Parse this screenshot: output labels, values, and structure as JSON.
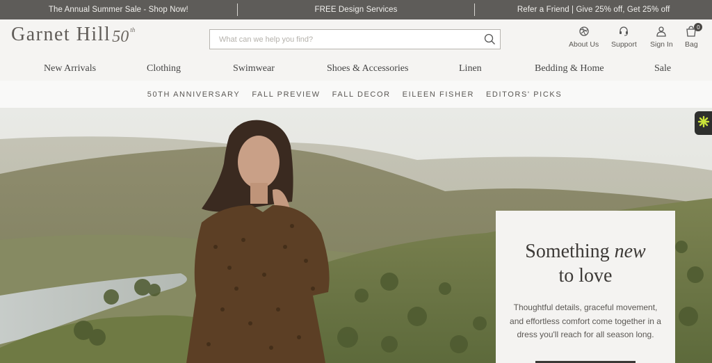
{
  "promo_bar": {
    "items": [
      "The Annual Summer Sale - Shop Now!",
      "FREE Design Services",
      "Refer a Friend | Give 25% off, Get 25% off"
    ]
  },
  "header": {
    "logo_text": "Garnet Hill",
    "logo_anniversary": "50",
    "logo_anniversary_suffix": "th",
    "search_placeholder": "What can we help you find?",
    "utility": {
      "about": "About Us",
      "support": "Support",
      "signin": "Sign In",
      "bag": "Bag",
      "bag_count": "0"
    }
  },
  "main_nav": [
    "New Arrivals",
    "Clothing",
    "Swimwear",
    "Shoes & Accessories",
    "Linen",
    "Bedding & Home",
    "Sale"
  ],
  "sub_nav": [
    "50TH ANNIVERSARY",
    "FALL PREVIEW",
    "FALL DECOR",
    "EILEEN FISHER",
    "EDITORS' PICKS"
  ],
  "hero_card": {
    "title_1": "Something ",
    "title_em": "new",
    "title_2": "to love",
    "body": "Thoughtful details, graceful movement, and effortless comfort come together in a dress you'll reach for all season long."
  },
  "colors": {
    "promo_bar": "#5e5c59",
    "header_bg": "#f5f4f2",
    "text": "#444444",
    "widget_accent": "#c9e23a"
  },
  "icons": {
    "about": "yarn-ball-icon",
    "support": "headset-icon",
    "signin": "user-icon",
    "bag": "shopping-bag-icon",
    "search": "search-icon",
    "widget": "accessibility-flower-icon"
  }
}
